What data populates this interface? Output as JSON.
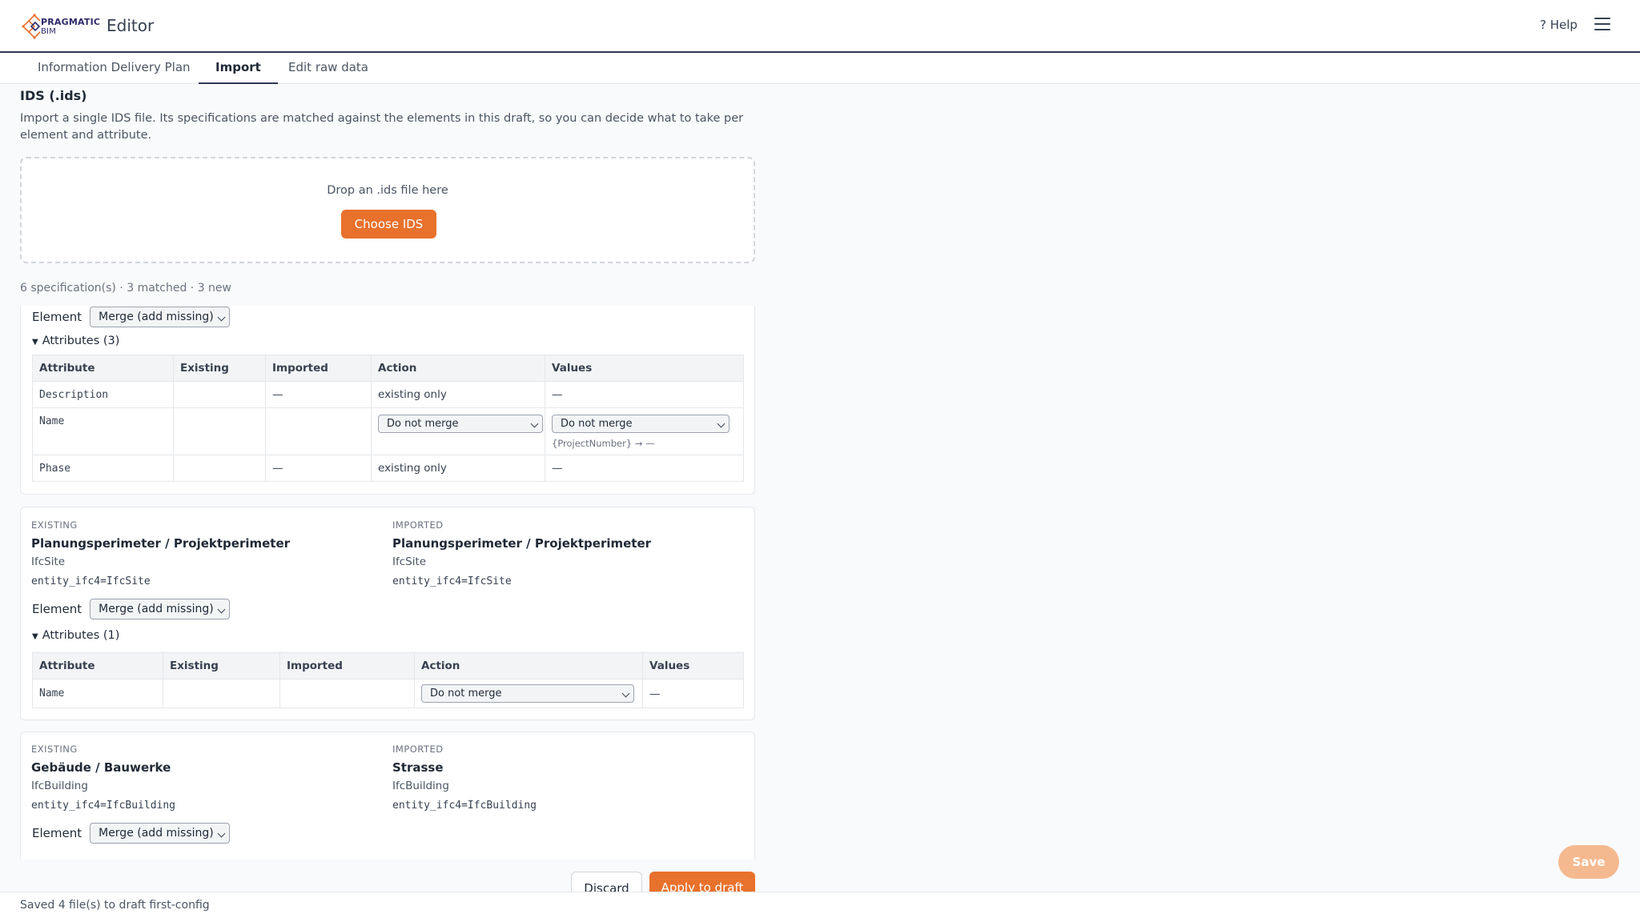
{
  "header": {
    "logo_line1": "PRAGMATIC",
    "logo_line2": "BIM",
    "app_title": "Editor",
    "help_label": "? Help"
  },
  "tabs": [
    {
      "label": "Information Delivery Plan",
      "active": false
    },
    {
      "label": "Import",
      "active": true
    },
    {
      "label": "Edit raw data",
      "active": false
    }
  ],
  "import": {
    "title": "IDS (.ids)",
    "description": "Import a single IDS file. Its specifications are matched against the elements in this draft, so you can decide what to take per element and attribute.",
    "drop_text": "Drop an .ids file here",
    "choose_label": "Choose IDS",
    "summary": "6 specification(s) · 3 matched · 3 new"
  },
  "labels": {
    "element": "Element",
    "existing": "EXISTING",
    "imported": "IMPORTED"
  },
  "card1": {
    "element_action": "Merge (add missing)",
    "attributes_toggle": "Attributes (3)",
    "columns": [
      "Attribute",
      "Existing",
      "Imported",
      "Action",
      "Values"
    ],
    "rows": [
      {
        "attribute": "Description",
        "existing": "",
        "imported": "—",
        "action": "existing only",
        "values": "—"
      },
      {
        "attribute": "Name",
        "existing": "",
        "imported": "",
        "action": "Do not merge",
        "values": "Do not merge",
        "values_hint": "{ProjectNumber} → —"
      },
      {
        "attribute": "Phase",
        "existing": "",
        "imported": "—",
        "action": "existing only",
        "values": "—"
      }
    ]
  },
  "card2": {
    "existing": {
      "name": "Planungsperimeter / Projektperimeter",
      "type": "IfcSite",
      "entity": "entity_ifc4=IfcSite"
    },
    "imported": {
      "name": "Planungsperimeter / Projektperimeter",
      "type": "IfcSite",
      "entity": "entity_ifc4=IfcSite"
    },
    "element_action": "Merge (add missing)",
    "attributes_toggle": "Attributes (1)",
    "columns": [
      "Attribute",
      "Existing",
      "Imported",
      "Action",
      "Values"
    ],
    "rows": [
      {
        "attribute": "Name",
        "existing": "",
        "imported": "",
        "action": "Do not merge",
        "values": "—"
      }
    ]
  },
  "card3": {
    "existing": {
      "name": "Gebäude / Bauwerke",
      "type": "IfcBuilding",
      "entity": "entity_ifc4=IfcBuilding"
    },
    "imported": {
      "name": "Strasse",
      "type": "IfcBuilding",
      "entity": "entity_ifc4=IfcBuilding"
    },
    "element_action": "Merge (add missing)"
  },
  "footer": {
    "discard_label": "Discard",
    "apply_label": "Apply to draft",
    "status": "Saved 4 file(s) to draft first-config",
    "save_label": "Save"
  },
  "colors": {
    "accent": "#e8712c",
    "nav_border": "#2e3a59",
    "save_fab": "#f5b98f"
  }
}
